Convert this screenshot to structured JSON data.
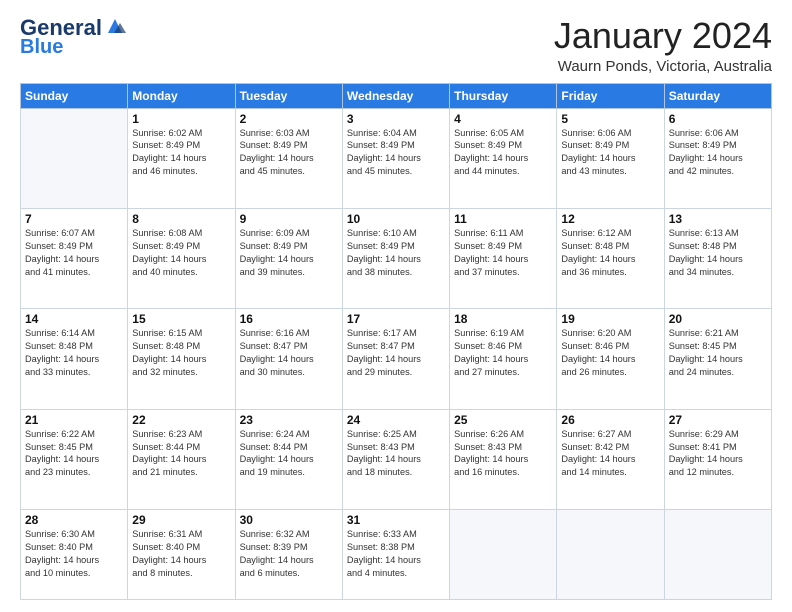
{
  "header": {
    "logo_line1": "General",
    "logo_line2": "Blue",
    "month_title": "January 2024",
    "location": "Waurn Ponds, Victoria, Australia"
  },
  "weekdays": [
    "Sunday",
    "Monday",
    "Tuesday",
    "Wednesday",
    "Thursday",
    "Friday",
    "Saturday"
  ],
  "weeks": [
    [
      {
        "day": "",
        "lines": []
      },
      {
        "day": "1",
        "lines": [
          "Sunrise: 6:02 AM",
          "Sunset: 8:49 PM",
          "Daylight: 14 hours",
          "and 46 minutes."
        ]
      },
      {
        "day": "2",
        "lines": [
          "Sunrise: 6:03 AM",
          "Sunset: 8:49 PM",
          "Daylight: 14 hours",
          "and 45 minutes."
        ]
      },
      {
        "day": "3",
        "lines": [
          "Sunrise: 6:04 AM",
          "Sunset: 8:49 PM",
          "Daylight: 14 hours",
          "and 45 minutes."
        ]
      },
      {
        "day": "4",
        "lines": [
          "Sunrise: 6:05 AM",
          "Sunset: 8:49 PM",
          "Daylight: 14 hours",
          "and 44 minutes."
        ]
      },
      {
        "day": "5",
        "lines": [
          "Sunrise: 6:06 AM",
          "Sunset: 8:49 PM",
          "Daylight: 14 hours",
          "and 43 minutes."
        ]
      },
      {
        "day": "6",
        "lines": [
          "Sunrise: 6:06 AM",
          "Sunset: 8:49 PM",
          "Daylight: 14 hours",
          "and 42 minutes."
        ]
      }
    ],
    [
      {
        "day": "7",
        "lines": [
          "Sunrise: 6:07 AM",
          "Sunset: 8:49 PM",
          "Daylight: 14 hours",
          "and 41 minutes."
        ]
      },
      {
        "day": "8",
        "lines": [
          "Sunrise: 6:08 AM",
          "Sunset: 8:49 PM",
          "Daylight: 14 hours",
          "and 40 minutes."
        ]
      },
      {
        "day": "9",
        "lines": [
          "Sunrise: 6:09 AM",
          "Sunset: 8:49 PM",
          "Daylight: 14 hours",
          "and 39 minutes."
        ]
      },
      {
        "day": "10",
        "lines": [
          "Sunrise: 6:10 AM",
          "Sunset: 8:49 PM",
          "Daylight: 14 hours",
          "and 38 minutes."
        ]
      },
      {
        "day": "11",
        "lines": [
          "Sunrise: 6:11 AM",
          "Sunset: 8:49 PM",
          "Daylight: 14 hours",
          "and 37 minutes."
        ]
      },
      {
        "day": "12",
        "lines": [
          "Sunrise: 6:12 AM",
          "Sunset: 8:48 PM",
          "Daylight: 14 hours",
          "and 36 minutes."
        ]
      },
      {
        "day": "13",
        "lines": [
          "Sunrise: 6:13 AM",
          "Sunset: 8:48 PM",
          "Daylight: 14 hours",
          "and 34 minutes."
        ]
      }
    ],
    [
      {
        "day": "14",
        "lines": [
          "Sunrise: 6:14 AM",
          "Sunset: 8:48 PM",
          "Daylight: 14 hours",
          "and 33 minutes."
        ]
      },
      {
        "day": "15",
        "lines": [
          "Sunrise: 6:15 AM",
          "Sunset: 8:48 PM",
          "Daylight: 14 hours",
          "and 32 minutes."
        ]
      },
      {
        "day": "16",
        "lines": [
          "Sunrise: 6:16 AM",
          "Sunset: 8:47 PM",
          "Daylight: 14 hours",
          "and 30 minutes."
        ]
      },
      {
        "day": "17",
        "lines": [
          "Sunrise: 6:17 AM",
          "Sunset: 8:47 PM",
          "Daylight: 14 hours",
          "and 29 minutes."
        ]
      },
      {
        "day": "18",
        "lines": [
          "Sunrise: 6:19 AM",
          "Sunset: 8:46 PM",
          "Daylight: 14 hours",
          "and 27 minutes."
        ]
      },
      {
        "day": "19",
        "lines": [
          "Sunrise: 6:20 AM",
          "Sunset: 8:46 PM",
          "Daylight: 14 hours",
          "and 26 minutes."
        ]
      },
      {
        "day": "20",
        "lines": [
          "Sunrise: 6:21 AM",
          "Sunset: 8:45 PM",
          "Daylight: 14 hours",
          "and 24 minutes."
        ]
      }
    ],
    [
      {
        "day": "21",
        "lines": [
          "Sunrise: 6:22 AM",
          "Sunset: 8:45 PM",
          "Daylight: 14 hours",
          "and 23 minutes."
        ]
      },
      {
        "day": "22",
        "lines": [
          "Sunrise: 6:23 AM",
          "Sunset: 8:44 PM",
          "Daylight: 14 hours",
          "and 21 minutes."
        ]
      },
      {
        "day": "23",
        "lines": [
          "Sunrise: 6:24 AM",
          "Sunset: 8:44 PM",
          "Daylight: 14 hours",
          "and 19 minutes."
        ]
      },
      {
        "day": "24",
        "lines": [
          "Sunrise: 6:25 AM",
          "Sunset: 8:43 PM",
          "Daylight: 14 hours",
          "and 18 minutes."
        ]
      },
      {
        "day": "25",
        "lines": [
          "Sunrise: 6:26 AM",
          "Sunset: 8:43 PM",
          "Daylight: 14 hours",
          "and 16 minutes."
        ]
      },
      {
        "day": "26",
        "lines": [
          "Sunrise: 6:27 AM",
          "Sunset: 8:42 PM",
          "Daylight: 14 hours",
          "and 14 minutes."
        ]
      },
      {
        "day": "27",
        "lines": [
          "Sunrise: 6:29 AM",
          "Sunset: 8:41 PM",
          "Daylight: 14 hours",
          "and 12 minutes."
        ]
      }
    ],
    [
      {
        "day": "28",
        "lines": [
          "Sunrise: 6:30 AM",
          "Sunset: 8:40 PM",
          "Daylight: 14 hours",
          "and 10 minutes."
        ]
      },
      {
        "day": "29",
        "lines": [
          "Sunrise: 6:31 AM",
          "Sunset: 8:40 PM",
          "Daylight: 14 hours",
          "and 8 minutes."
        ]
      },
      {
        "day": "30",
        "lines": [
          "Sunrise: 6:32 AM",
          "Sunset: 8:39 PM",
          "Daylight: 14 hours",
          "and 6 minutes."
        ]
      },
      {
        "day": "31",
        "lines": [
          "Sunrise: 6:33 AM",
          "Sunset: 8:38 PM",
          "Daylight: 14 hours",
          "and 4 minutes."
        ]
      },
      {
        "day": "",
        "lines": []
      },
      {
        "day": "",
        "lines": []
      },
      {
        "day": "",
        "lines": []
      }
    ]
  ]
}
